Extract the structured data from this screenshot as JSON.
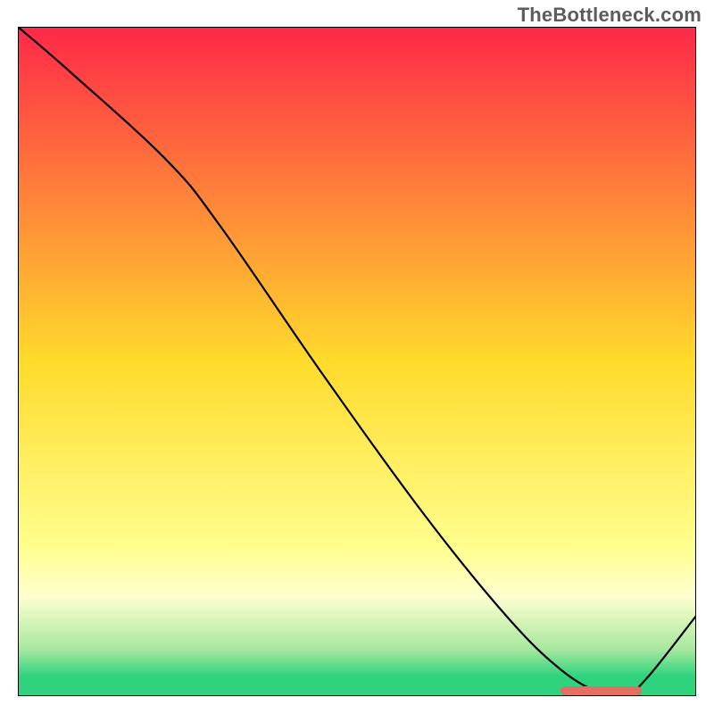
{
  "domain": "Chart",
  "watermark": "TheBottleneck.com",
  "chart_data": {
    "type": "line",
    "title": "",
    "xlabel": "",
    "ylabel": "",
    "xlim": [
      0,
      100
    ],
    "ylim": [
      0,
      100
    ],
    "grid": false,
    "line_color": "#000000",
    "line_width": 2.2,
    "background_gradient_stops": [
      {
        "offset": 0.0,
        "color": "#ff2848"
      },
      {
        "offset": 0.5,
        "color": "#ffdb2b"
      },
      {
        "offset": 0.78,
        "color": "#ffff8f"
      },
      {
        "offset": 0.85,
        "color": "#ffffcf"
      },
      {
        "offset": 0.93,
        "color": "#a8e89f"
      },
      {
        "offset": 0.97,
        "color": "#2fd37e"
      },
      {
        "offset": 1.0,
        "color": "#2fd37e"
      }
    ],
    "x": [
      0,
      8,
      22,
      30,
      45,
      60,
      72,
      80,
      86,
      90,
      93,
      100
    ],
    "values": [
      100,
      93,
      80,
      70,
      48,
      27,
      12,
      4,
      0.5,
      0.5,
      3,
      12
    ],
    "marker_band": {
      "x_start": 80,
      "x_end": 92,
      "color": "#e36f62"
    }
  }
}
